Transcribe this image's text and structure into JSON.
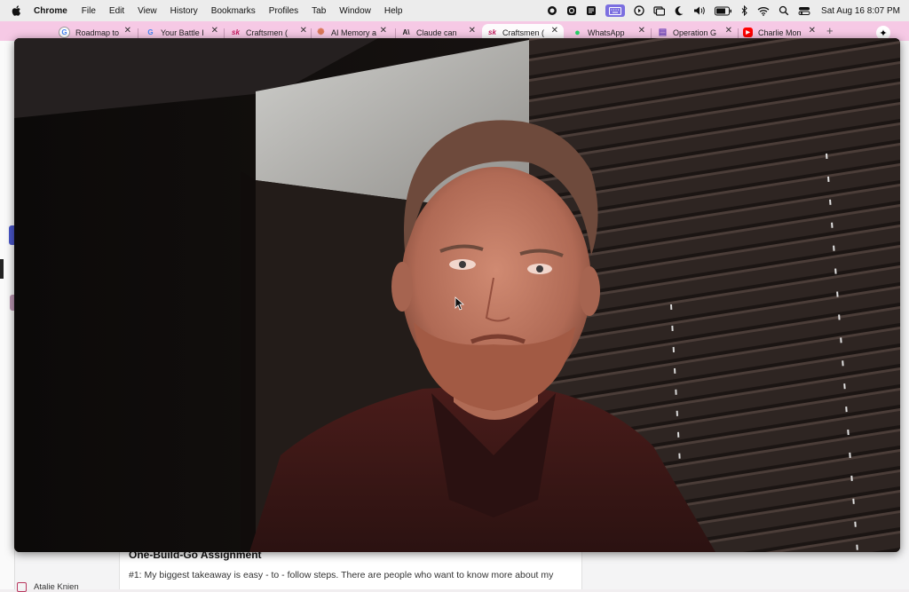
{
  "menubar": {
    "app_name": "Chrome",
    "menus": [
      "File",
      "Edit",
      "View",
      "History",
      "Bookmarks",
      "Profiles",
      "Tab",
      "Window",
      "Help"
    ],
    "clock": "Sat Aug 16  8:07 PM"
  },
  "tabs": [
    {
      "title": "Roadmap to",
      "favicon": "G",
      "icon": "google-icon",
      "color": "#4285f4"
    },
    {
      "title": "Your Battle I",
      "favicon": "G",
      "icon": "google-icon",
      "color": "#4285f4"
    },
    {
      "title": "Craftsmen (",
      "favicon": "sk",
      "icon": "skool-icon",
      "color": "#c2185b"
    },
    {
      "title": "AI Memory a",
      "favicon": "✺",
      "icon": "claude-icon",
      "color": "#d97757"
    },
    {
      "title": "Claude can",
      "favicon": "A\\",
      "icon": "anthropic-icon",
      "color": "#222222"
    },
    {
      "title": "Craftsmen (",
      "favicon": "sk",
      "icon": "skool-icon",
      "color": "#c2185b",
      "active": true
    },
    {
      "title": "WhatsApp",
      "favicon": "●",
      "icon": "whatsapp-icon",
      "color": "#25d366"
    },
    {
      "title": "Operation G",
      "favicon": "▤",
      "icon": "forms-icon",
      "color": "#7248b9"
    },
    {
      "title": "Charlie Mon",
      "favicon": "▶",
      "icon": "youtube-icon",
      "color": "#ff0000"
    }
  ],
  "document": {
    "heading": "One-Build-Go Assignment",
    "body": "#1: My biggest takeaway is easy - to - follow steps. There are people who want to know more about my"
  },
  "footer": {
    "member_name": "Atalie Knien"
  }
}
